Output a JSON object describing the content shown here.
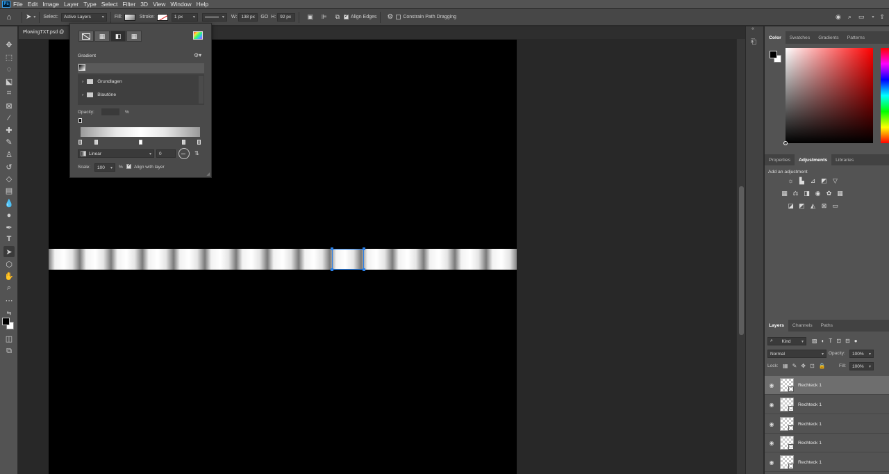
{
  "app": {
    "logo": "Ps"
  },
  "menu": [
    "File",
    "Edit",
    "Image",
    "Layer",
    "Type",
    "Select",
    "Filter",
    "3D",
    "View",
    "Window",
    "Help"
  ],
  "options": {
    "select_label": "Select:",
    "select_value": "Active Layers",
    "fill_label": "Fill:",
    "stroke_label": "Stroke:",
    "stroke_width": "1 px",
    "w_label": "W:",
    "w_value": "138 px",
    "link_label": "GO",
    "h_label": "H:",
    "h_value": "92 px",
    "align_edges": "Align Edges",
    "constrain": "Constrain Path Dragging"
  },
  "document": {
    "tab": "PlowingTXT.psd @"
  },
  "gradient_popup": {
    "section": "Gradient",
    "folders": [
      "Grundlagen",
      "Blautöne"
    ],
    "opacity_label": "Opacity:",
    "opacity_unit": "%",
    "style": "Linear",
    "angle": "0",
    "scale_label": "Scale:",
    "scale_value": "100",
    "scale_unit": "%",
    "align_layer": "Align with layer"
  },
  "panels": {
    "color_tabs": [
      "Color",
      "Swatches",
      "Gradients",
      "Patterns"
    ],
    "adj_tabs": [
      "Properties",
      "Adjustments",
      "Libraries"
    ],
    "adj_title": "Add an adjustment",
    "layer_tabs": [
      "Layers",
      "Channels",
      "Paths"
    ],
    "kind": "Kind",
    "blend": "Normal",
    "opacity_label": "Opacity:",
    "opacity_value": "100%",
    "lock_label": "Lock:",
    "fill_label": "Fill:",
    "fill_value": "100%",
    "layers": [
      "Rechteck 1",
      "Rechteck 1",
      "Rechteck 1",
      "Rechteck 1",
      "Rechteck 1"
    ]
  },
  "colors": {
    "accent": "#2a7fe6",
    "fg": "#000000",
    "bg": "#ffffff"
  }
}
